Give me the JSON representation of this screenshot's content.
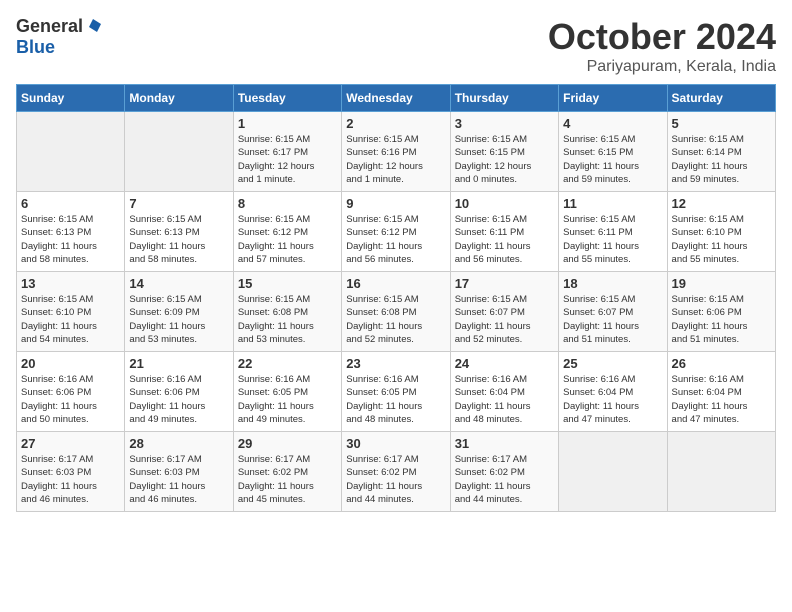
{
  "logo": {
    "general": "General",
    "blue": "Blue"
  },
  "title": "October 2024",
  "location": "Pariyapuram, Kerala, India",
  "headers": [
    "Sunday",
    "Monday",
    "Tuesday",
    "Wednesday",
    "Thursday",
    "Friday",
    "Saturday"
  ],
  "weeks": [
    [
      {
        "day": "",
        "info": ""
      },
      {
        "day": "",
        "info": ""
      },
      {
        "day": "1",
        "info": "Sunrise: 6:15 AM\nSunset: 6:17 PM\nDaylight: 12 hours\nand 1 minute."
      },
      {
        "day": "2",
        "info": "Sunrise: 6:15 AM\nSunset: 6:16 PM\nDaylight: 12 hours\nand 1 minute."
      },
      {
        "day": "3",
        "info": "Sunrise: 6:15 AM\nSunset: 6:15 PM\nDaylight: 12 hours\nand 0 minutes."
      },
      {
        "day": "4",
        "info": "Sunrise: 6:15 AM\nSunset: 6:15 PM\nDaylight: 11 hours\nand 59 minutes."
      },
      {
        "day": "5",
        "info": "Sunrise: 6:15 AM\nSunset: 6:14 PM\nDaylight: 11 hours\nand 59 minutes."
      }
    ],
    [
      {
        "day": "6",
        "info": "Sunrise: 6:15 AM\nSunset: 6:13 PM\nDaylight: 11 hours\nand 58 minutes."
      },
      {
        "day": "7",
        "info": "Sunrise: 6:15 AM\nSunset: 6:13 PM\nDaylight: 11 hours\nand 58 minutes."
      },
      {
        "day": "8",
        "info": "Sunrise: 6:15 AM\nSunset: 6:12 PM\nDaylight: 11 hours\nand 57 minutes."
      },
      {
        "day": "9",
        "info": "Sunrise: 6:15 AM\nSunset: 6:12 PM\nDaylight: 11 hours\nand 56 minutes."
      },
      {
        "day": "10",
        "info": "Sunrise: 6:15 AM\nSunset: 6:11 PM\nDaylight: 11 hours\nand 56 minutes."
      },
      {
        "day": "11",
        "info": "Sunrise: 6:15 AM\nSunset: 6:11 PM\nDaylight: 11 hours\nand 55 minutes."
      },
      {
        "day": "12",
        "info": "Sunrise: 6:15 AM\nSunset: 6:10 PM\nDaylight: 11 hours\nand 55 minutes."
      }
    ],
    [
      {
        "day": "13",
        "info": "Sunrise: 6:15 AM\nSunset: 6:10 PM\nDaylight: 11 hours\nand 54 minutes."
      },
      {
        "day": "14",
        "info": "Sunrise: 6:15 AM\nSunset: 6:09 PM\nDaylight: 11 hours\nand 53 minutes."
      },
      {
        "day": "15",
        "info": "Sunrise: 6:15 AM\nSunset: 6:08 PM\nDaylight: 11 hours\nand 53 minutes."
      },
      {
        "day": "16",
        "info": "Sunrise: 6:15 AM\nSunset: 6:08 PM\nDaylight: 11 hours\nand 52 minutes."
      },
      {
        "day": "17",
        "info": "Sunrise: 6:15 AM\nSunset: 6:07 PM\nDaylight: 11 hours\nand 52 minutes."
      },
      {
        "day": "18",
        "info": "Sunrise: 6:15 AM\nSunset: 6:07 PM\nDaylight: 11 hours\nand 51 minutes."
      },
      {
        "day": "19",
        "info": "Sunrise: 6:15 AM\nSunset: 6:06 PM\nDaylight: 11 hours\nand 51 minutes."
      }
    ],
    [
      {
        "day": "20",
        "info": "Sunrise: 6:16 AM\nSunset: 6:06 PM\nDaylight: 11 hours\nand 50 minutes."
      },
      {
        "day": "21",
        "info": "Sunrise: 6:16 AM\nSunset: 6:06 PM\nDaylight: 11 hours\nand 49 minutes."
      },
      {
        "day": "22",
        "info": "Sunrise: 6:16 AM\nSunset: 6:05 PM\nDaylight: 11 hours\nand 49 minutes."
      },
      {
        "day": "23",
        "info": "Sunrise: 6:16 AM\nSunset: 6:05 PM\nDaylight: 11 hours\nand 48 minutes."
      },
      {
        "day": "24",
        "info": "Sunrise: 6:16 AM\nSunset: 6:04 PM\nDaylight: 11 hours\nand 48 minutes."
      },
      {
        "day": "25",
        "info": "Sunrise: 6:16 AM\nSunset: 6:04 PM\nDaylight: 11 hours\nand 47 minutes."
      },
      {
        "day": "26",
        "info": "Sunrise: 6:16 AM\nSunset: 6:04 PM\nDaylight: 11 hours\nand 47 minutes."
      }
    ],
    [
      {
        "day": "27",
        "info": "Sunrise: 6:17 AM\nSunset: 6:03 PM\nDaylight: 11 hours\nand 46 minutes."
      },
      {
        "day": "28",
        "info": "Sunrise: 6:17 AM\nSunset: 6:03 PM\nDaylight: 11 hours\nand 46 minutes."
      },
      {
        "day": "29",
        "info": "Sunrise: 6:17 AM\nSunset: 6:02 PM\nDaylight: 11 hours\nand 45 minutes."
      },
      {
        "day": "30",
        "info": "Sunrise: 6:17 AM\nSunset: 6:02 PM\nDaylight: 11 hours\nand 44 minutes."
      },
      {
        "day": "31",
        "info": "Sunrise: 6:17 AM\nSunset: 6:02 PM\nDaylight: 11 hours\nand 44 minutes."
      },
      {
        "day": "",
        "info": ""
      },
      {
        "day": "",
        "info": ""
      }
    ]
  ]
}
